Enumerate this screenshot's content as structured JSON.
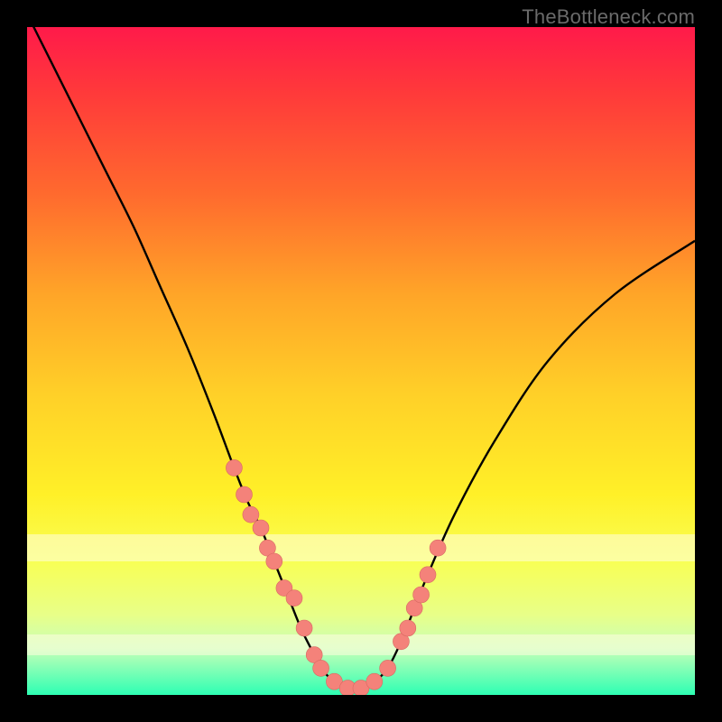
{
  "attribution": "TheBottleneck.com",
  "colors": {
    "frame": "#000000",
    "curve": "#000000",
    "marker_fill": "#f4827a",
    "marker_stroke": "#d86a62",
    "gradient_top": "#ff1a4a",
    "gradient_bottom": "#2dffb3",
    "cream_band": "#fffde0"
  },
  "chart_data": {
    "type": "line",
    "title": "",
    "xlabel": "",
    "ylabel": "",
    "xlim": [
      0,
      100
    ],
    "ylim": [
      0,
      100
    ],
    "grid": false,
    "legend": false,
    "series": [
      {
        "name": "bottleneck-curve",
        "x": [
          0,
          2,
          5,
          8,
          12,
          16,
          20,
          24,
          28,
          31,
          33,
          35,
          37,
          39,
          41,
          43,
          44,
          46,
          48,
          50,
          52,
          54,
          56,
          58,
          60,
          64,
          70,
          78,
          88,
          100
        ],
        "y": [
          102,
          98,
          92,
          86,
          78,
          70,
          61,
          52,
          42,
          34,
          29,
          25,
          20,
          15,
          10,
          6,
          4,
          2,
          1,
          1,
          2,
          4,
          8,
          13,
          18,
          27,
          38,
          50,
          60,
          68
        ]
      }
    ],
    "markers": {
      "left_cluster": {
        "x": [
          31,
          32.5,
          33.5,
          35,
          36,
          37,
          38.5,
          40,
          41.5,
          43
        ],
        "y": [
          34,
          30,
          27,
          25,
          22,
          20,
          16,
          14.5,
          10,
          6
        ]
      },
      "valley": {
        "x": [
          44,
          46,
          48,
          50,
          52,
          54
        ],
        "y": [
          4,
          2,
          1,
          1,
          2,
          4
        ]
      },
      "right_cluster": {
        "x": [
          56,
          57,
          58,
          59,
          60,
          61.5
        ],
        "y": [
          8,
          10,
          13,
          15,
          18,
          22
        ]
      }
    },
    "bands": [
      {
        "name": "cream-upper",
        "y_from": 20,
        "y_to": 24
      },
      {
        "name": "cream-lower",
        "y_from": 6,
        "y_to": 9
      }
    ]
  }
}
